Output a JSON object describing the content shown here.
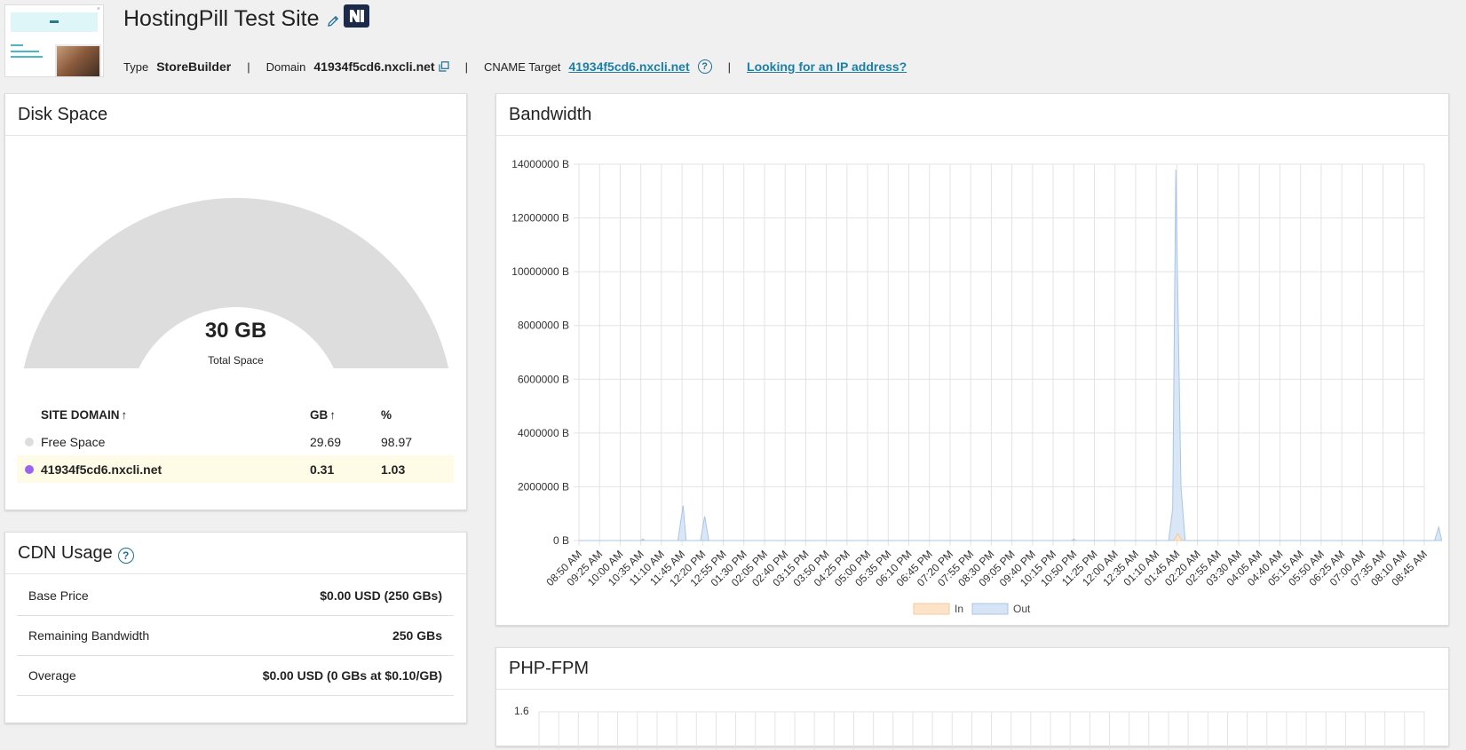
{
  "site": {
    "title": "HostingPill Test Site",
    "type_label": "Type",
    "type_value": "StoreBuilder",
    "domain_label": "Domain",
    "domain_value": "41934f5cd6.nxcli.net",
    "cname_label": "CNAME Target",
    "cname_value": "41934f5cd6.nxcli.net",
    "ip_link": "Looking for an IP address?",
    "separator": "|"
  },
  "disk": {
    "title": "Disk Space",
    "total_value": "30 GB",
    "total_label": "Total Space",
    "headers": {
      "domain": "SITE DOMAIN",
      "gb": "GB",
      "pct": "%",
      "sort_arrow": "↑"
    },
    "rows": [
      {
        "name": "Free Space",
        "gb": "29.69",
        "pct": "98.97",
        "color": "#dddddd"
      },
      {
        "name": "41934f5cd6.nxcli.net",
        "gb": "0.31",
        "pct": "1.03",
        "color": "#9b63f3"
      }
    ],
    "used_fraction": 0.0103
  },
  "cdn": {
    "title": "CDN Usage",
    "rows": [
      {
        "label": "Base Price",
        "value": "$0.00 USD (250 GBs)"
      },
      {
        "label": "Remaining Bandwidth",
        "value": "250 GBs"
      },
      {
        "label": "Overage",
        "value": "$0.00 USD (0 GBs at $0.10/GB)"
      }
    ]
  },
  "bandwidth": {
    "title": "Bandwidth"
  },
  "php": {
    "title": "PHP-FPM",
    "first_tick": "1.6"
  },
  "chart_data": {
    "type": "area",
    "title": "Bandwidth",
    "ylim": [
      0,
      14000000
    ],
    "yticks": [
      "0 B",
      "2000000 B",
      "4000000 B",
      "6000000 B",
      "8000000 B",
      "10000000 B",
      "12000000 B",
      "14000000 B"
    ],
    "x": [
      "08:50 AM",
      "09:25 AM",
      "10:00 AM",
      "10:35 AM",
      "11:10 AM",
      "11:45 AM",
      "12:20 PM",
      "12:55 PM",
      "01:30 PM",
      "02:05 PM",
      "02:40 PM",
      "03:15 PM",
      "03:50 PM",
      "04:25 PM",
      "05:00 PM",
      "05:35 PM",
      "06:10 PM",
      "06:45 PM",
      "07:20 PM",
      "07:55 PM",
      "08:30 PM",
      "09:05 PM",
      "09:40 PM",
      "10:15 PM",
      "10:50 PM",
      "11:25 PM",
      "12:00 AM",
      "12:35 AM",
      "01:10 AM",
      "01:45 AM",
      "02:20 AM",
      "02:55 AM",
      "03:30 AM",
      "04:05 AM",
      "04:40 AM",
      "05:15 AM",
      "05:50 AM",
      "06:25 AM",
      "07:00 AM",
      "07:35 AM",
      "08:10 AM",
      "08:45 AM"
    ],
    "legend": "bottom",
    "series": [
      {
        "name": "In",
        "color": "#fde4c8",
        "stroke": "#f5c89a",
        "points": [
          [
            28.85,
            0
          ],
          [
            29.05,
            250000
          ],
          [
            29.25,
            0
          ]
        ]
      },
      {
        "name": "Out",
        "color": "#d6e4f5",
        "stroke": "#a9c4e6",
        "points": [
          [
            0,
            0
          ],
          [
            3.0,
            0
          ],
          [
            3.1,
            60000
          ],
          [
            3.2,
            0
          ],
          [
            4.8,
            0
          ],
          [
            5.05,
            1300000
          ],
          [
            5.2,
            0
          ],
          [
            5.9,
            0
          ],
          [
            6.1,
            900000
          ],
          [
            6.3,
            0
          ],
          [
            23.9,
            0
          ],
          [
            24.0,
            60000
          ],
          [
            24.1,
            0
          ],
          [
            28.6,
            0
          ],
          [
            28.8,
            1200000
          ],
          [
            28.95,
            13800000
          ],
          [
            29.05,
            9000000
          ],
          [
            29.2,
            2000000
          ],
          [
            29.4,
            0
          ],
          [
            41.5,
            0
          ],
          [
            41.7,
            500000
          ],
          [
            41.85,
            0
          ]
        ]
      }
    ]
  }
}
